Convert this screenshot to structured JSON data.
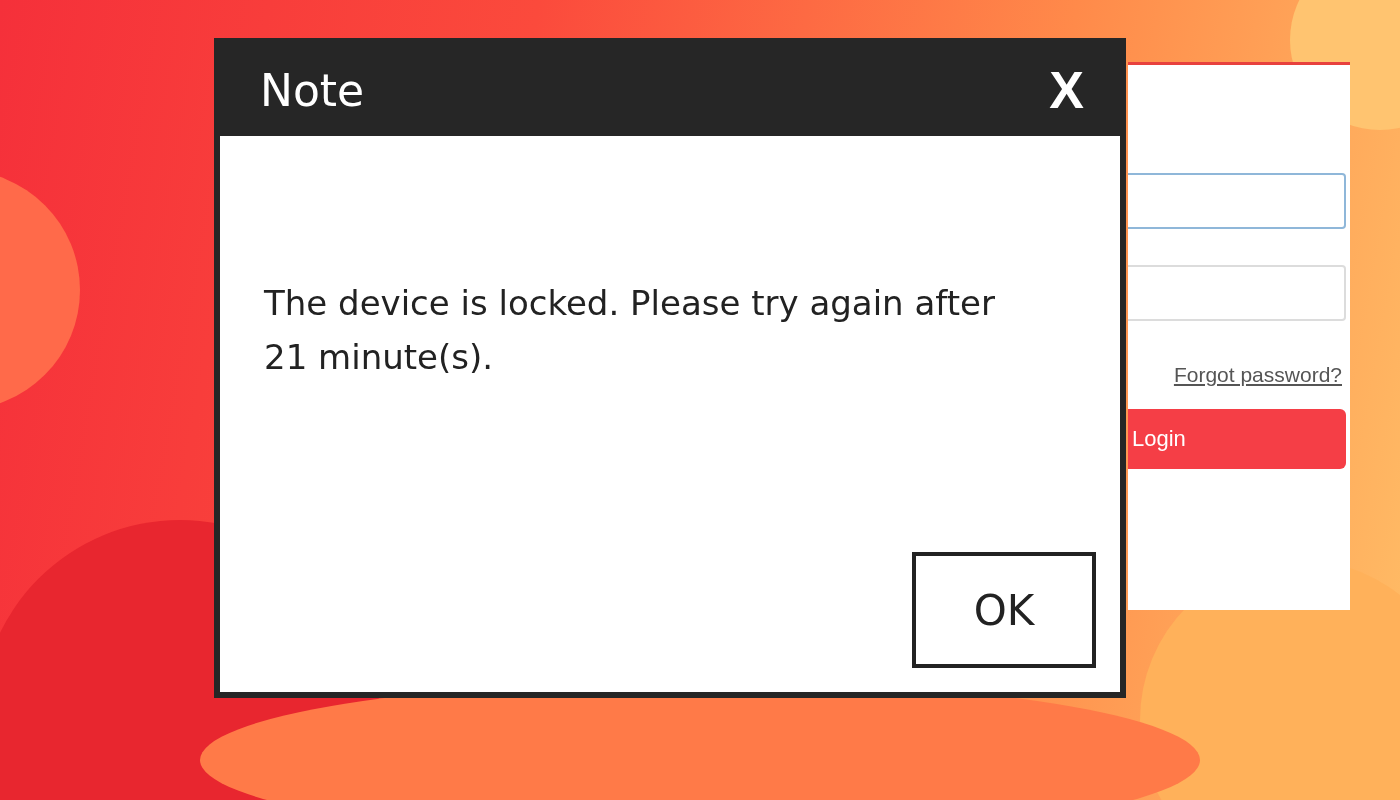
{
  "login_panel": {
    "fields": [
      {
        "focused": true
      },
      {
        "focused": false
      }
    ],
    "forgot_link": "Forgot password?",
    "login_button": "Login"
  },
  "dialog": {
    "title": "Note",
    "close": "X",
    "message": "The device is locked. Please try again after 21 minute(s).",
    "ok_button": "OK"
  }
}
